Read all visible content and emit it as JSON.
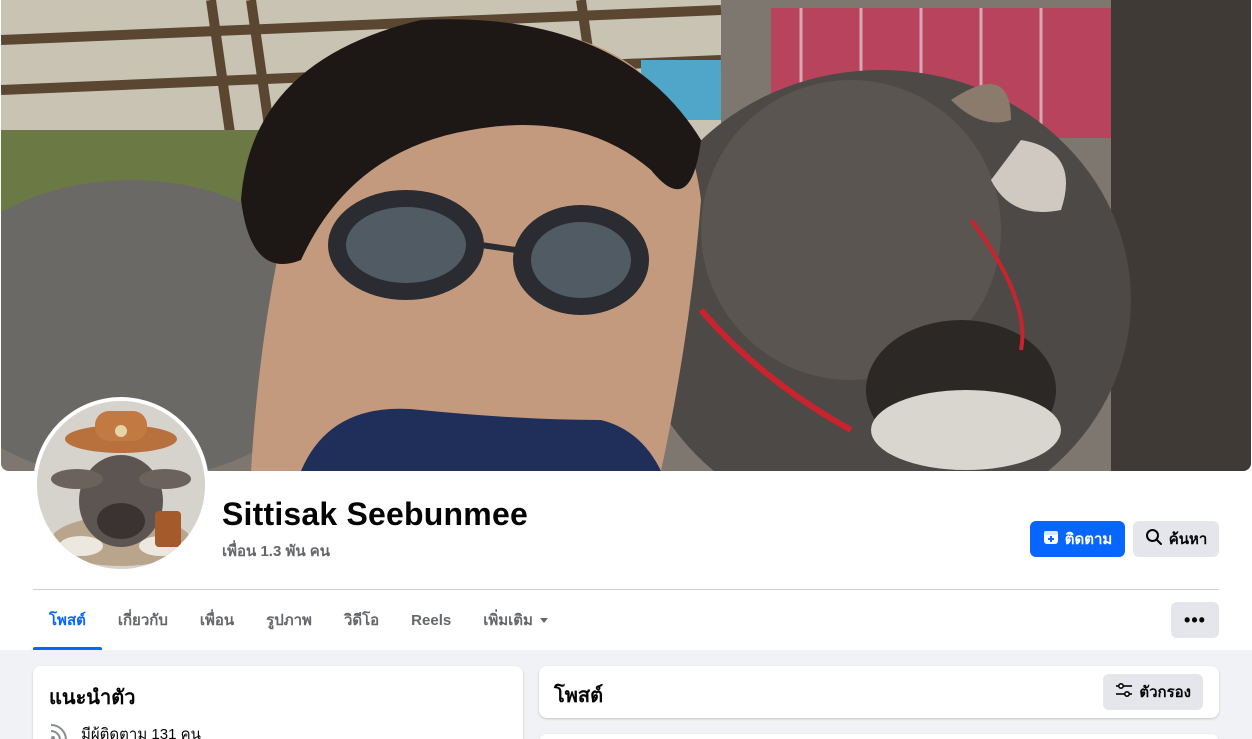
{
  "profile": {
    "name": "Sittisak Seebunmee",
    "friends": "เพื่อน 1.3 พัน คน"
  },
  "actions": {
    "follow_label": "ติดตาม",
    "search_label": "ค้นหา"
  },
  "tabs": [
    {
      "label": "โพสต์",
      "active": true
    },
    {
      "label": "เกี่ยวกับ",
      "active": false
    },
    {
      "label": "เพื่อน",
      "active": false
    },
    {
      "label": "รูปภาพ",
      "active": false
    },
    {
      "label": "วิดีโอ",
      "active": false
    },
    {
      "label": "Reels",
      "active": false
    },
    {
      "label": "เพิ่มเติม",
      "active": false
    }
  ],
  "more_button": "•••",
  "intro": {
    "title": "แนะนำตัว",
    "followers": "มีผู้ติดตาม 131 คน"
  },
  "posts": {
    "title": "โพสต์",
    "filter_label": "ตัวกรอง"
  },
  "colors": {
    "accent": "#0866ff",
    "secondary_button": "#e4e6eb",
    "muted_text": "#65676b",
    "feed_background": "#f0f2f5"
  }
}
